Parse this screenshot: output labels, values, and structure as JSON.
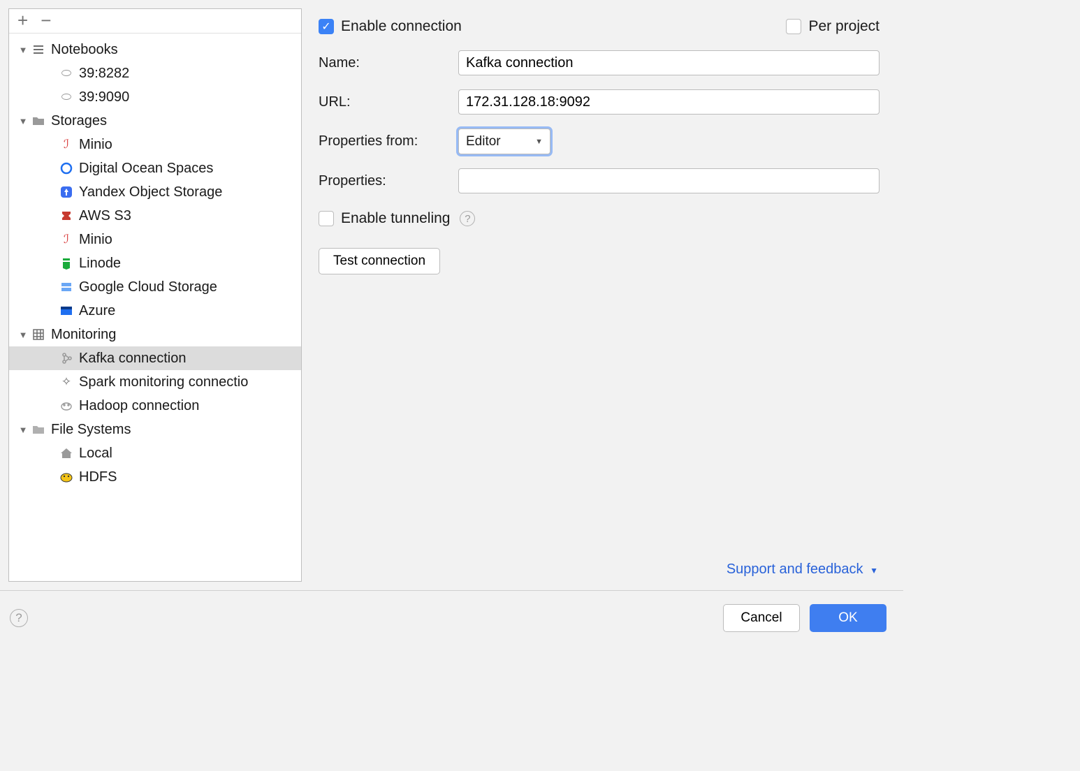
{
  "sidebar": {
    "toolbar": {
      "add": "+",
      "remove": "−"
    },
    "groups": [
      {
        "label": "Notebooks",
        "icon": "list-icon",
        "items": [
          {
            "label": "39:8282",
            "icon": "link-icon"
          },
          {
            "label": "39:9090",
            "icon": "link-icon"
          }
        ]
      },
      {
        "label": "Storages",
        "icon": "folder-icon",
        "items": [
          {
            "label": "Minio",
            "icon": "minio-icon"
          },
          {
            "label": "Digital Ocean Spaces",
            "icon": "do-icon"
          },
          {
            "label": "Yandex Object Storage",
            "icon": "yandex-icon"
          },
          {
            "label": "AWS S3",
            "icon": "aws-icon"
          },
          {
            "label": "Minio",
            "icon": "minio-icon"
          },
          {
            "label": "Linode",
            "icon": "linode-icon"
          },
          {
            "label": "Google Cloud Storage",
            "icon": "gcs-icon"
          },
          {
            "label": "Azure",
            "icon": "azure-icon"
          }
        ]
      },
      {
        "label": "Monitoring",
        "icon": "grid-icon",
        "items": [
          {
            "label": "Kafka connection",
            "icon": "kafka-icon",
            "selected": true
          },
          {
            "label": "Spark monitoring connectio",
            "icon": "spark-icon"
          },
          {
            "label": "Hadoop connection",
            "icon": "hadoop-icon"
          }
        ]
      },
      {
        "label": "File Systems",
        "icon": "folder-plain-icon",
        "items": [
          {
            "label": "Local",
            "icon": "home-icon"
          },
          {
            "label": "HDFS",
            "icon": "hdfs-icon"
          }
        ]
      }
    ]
  },
  "form": {
    "enable_connection_label": "Enable connection",
    "enable_connection_checked": true,
    "per_project_label": "Per project",
    "per_project_checked": false,
    "name_label": "Name:",
    "name_value": "Kafka connection",
    "url_label": "URL:",
    "url_value": "172.31.128.18:9092",
    "properties_from_label": "Properties from:",
    "properties_from_value": "Editor",
    "properties_label": "Properties:",
    "properties_value": "",
    "enable_tunneling_label": "Enable tunneling",
    "enable_tunneling_checked": false,
    "test_connection_label": "Test connection"
  },
  "support_link_label": "Support and feedback",
  "footer": {
    "cancel_label": "Cancel",
    "ok_label": "OK"
  }
}
